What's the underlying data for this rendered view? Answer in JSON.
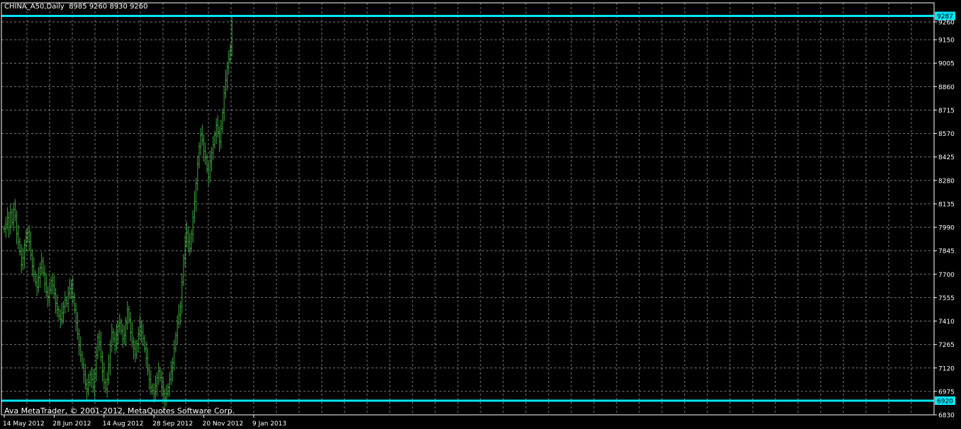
{
  "window": {
    "symbol_label": "CHINA_A50,Daily",
    "ohlc": "8985 9260 8930 9260",
    "copyright": "Ava MetaTrader, © 2001-2012, MetaQuotes Software Corp."
  },
  "colors": {
    "background": "#000000",
    "grid": "#7a7a7a",
    "frame": "#ffffff",
    "bar": "#3ea63e",
    "hline": "#00e5f5",
    "text": "#ffffff"
  },
  "chart_data": {
    "type": "ohlc",
    "title": "CHINA_A50,Daily",
    "grid": true,
    "y_ticks": [
      9260,
      9150,
      9005,
      8860,
      8715,
      8570,
      8425,
      8280,
      8135,
      7990,
      7845,
      7700,
      7555,
      7410,
      7265,
      7120,
      6975,
      6830
    ],
    "x_tick_labels": [
      "14 May 2012",
      "28 Jun 2012",
      "14 Aug 2012",
      "28 Sep 2012",
      "20 Nov 2012",
      "9 Jan 2013"
    ],
    "x_tick_bar_index": [
      0,
      32,
      64,
      96,
      128,
      160
    ],
    "horizontal_lines": [
      {
        "label": "9287",
        "value": 9287
      },
      {
        "label": "6920",
        "value": 6920
      }
    ],
    "closes": [
      7980,
      8010,
      8050,
      7990,
      8080,
      8020,
      8100,
      8060,
      7950,
      7900,
      7840,
      7760,
      7800,
      7880,
      7920,
      7960,
      7900,
      7820,
      7750,
      7700,
      7650,
      7620,
      7680,
      7740,
      7780,
      7710,
      7640,
      7590,
      7560,
      7600,
      7660,
      7630,
      7580,
      7520,
      7480,
      7440,
      7420,
      7460,
      7500,
      7540,
      7520,
      7580,
      7610,
      7630,
      7560,
      7480,
      7400,
      7330,
      7260,
      7200,
      7140,
      7080,
      7020,
      6990,
      7030,
      7080,
      7050,
      7000,
      7080,
      7200,
      7310,
      7280,
      7190,
      7100,
      7030,
      6990,
      7050,
      7140,
      7260,
      7340,
      7300,
      7260,
      7330,
      7380,
      7400,
      7350,
      7300,
      7320,
      7400,
      7480,
      7420,
      7340,
      7280,
      7240,
      7200,
      7270,
      7330,
      7380,
      7340,
      7300,
      7240,
      7180,
      7110,
      7050,
      7000,
      6980,
      6960,
      7010,
      7060,
      7100,
      7060,
      7000,
      6960,
      6930,
      6960,
      7000,
      7050,
      7100,
      7150,
      7240,
      7320,
      7400,
      7450,
      7500,
      7650,
      7800,
      7900,
      7960,
      7900,
      7860,
      7950,
      8050,
      8150,
      8260,
      8380,
      8490,
      8560,
      8530,
      8460,
      8420,
      8350,
      8300,
      8400,
      8450,
      8500,
      8560,
      8620,
      8580,
      8520,
      8600,
      8700,
      8820,
      8900,
      8980,
      9030,
      9100,
      9260
    ]
  }
}
